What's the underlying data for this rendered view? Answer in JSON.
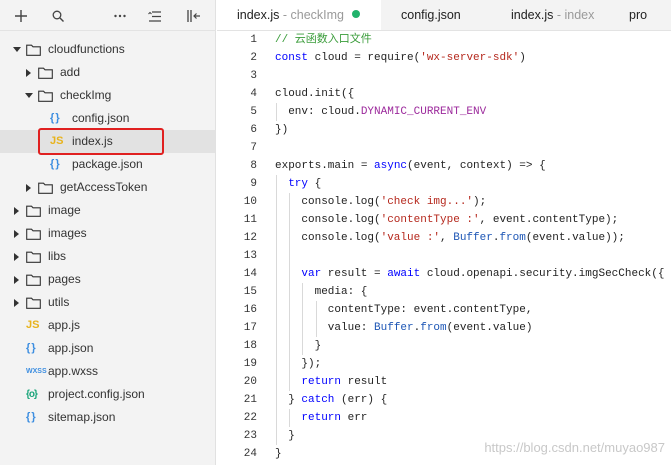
{
  "toolbar": {
    "icons": [
      "plus-icon",
      "search-icon",
      "more-icon",
      "sort-icon",
      "collapse-panel-icon"
    ]
  },
  "tree": [
    {
      "label": "cloudfunctions",
      "type": "folder",
      "open": true,
      "depth": 0
    },
    {
      "label": "add",
      "type": "folder",
      "open": false,
      "depth": 1
    },
    {
      "label": "checkImg",
      "type": "folder",
      "open": true,
      "depth": 1
    },
    {
      "label": "config.json",
      "type": "json",
      "depth": 2
    },
    {
      "label": "index.js",
      "type": "js",
      "depth": 2,
      "selected": true
    },
    {
      "label": "package.json",
      "type": "json",
      "depth": 2
    },
    {
      "label": "getAccessToken",
      "type": "folder",
      "open": false,
      "depth": 1
    },
    {
      "label": "image",
      "type": "folder",
      "open": false,
      "depth": 0
    },
    {
      "label": "images",
      "type": "folder",
      "open": false,
      "depth": 0
    },
    {
      "label": "libs",
      "type": "folder",
      "open": false,
      "depth": 0
    },
    {
      "label": "pages",
      "type": "folder",
      "open": false,
      "depth": 0
    },
    {
      "label": "utils",
      "type": "folder",
      "open": false,
      "depth": 0
    },
    {
      "label": "app.js",
      "type": "js",
      "depth": 0
    },
    {
      "label": "app.json",
      "type": "json",
      "depth": 0
    },
    {
      "label": "app.wxss",
      "type": "wxss",
      "depth": 0
    },
    {
      "label": "project.config.json",
      "type": "cfg",
      "depth": 0
    },
    {
      "label": "sitemap.json",
      "type": "json",
      "depth": 0
    }
  ],
  "file_badges": {
    "js": "JS",
    "json": "{ }",
    "wxss": "WXSS",
    "cfg": "{o}"
  },
  "tabs": [
    {
      "name": "index.js",
      "suffix": " - checkImg",
      "active": true,
      "modified_color": "#21b26b"
    },
    {
      "name": "config.json",
      "suffix": "",
      "active": false
    },
    {
      "name": "index.js",
      "suffix": " - index",
      "active": false
    },
    {
      "name": "pro",
      "suffix": "",
      "active": false
    }
  ],
  "code": [
    {
      "n": "1",
      "indent": 0,
      "tokens": [
        [
          "c",
          "// 云函数入口文件"
        ]
      ]
    },
    {
      "n": "2",
      "indent": 0,
      "tokens": [
        [
          "k",
          "const"
        ],
        [
          "p",
          " cloud = require("
        ],
        [
          "s",
          "'wx-server-sdk'"
        ],
        [
          "p",
          ")"
        ]
      ]
    },
    {
      "n": "3",
      "indent": 0,
      "tokens": []
    },
    {
      "n": "4",
      "indent": 0,
      "tokens": [
        [
          "p",
          "cloud.init({"
        ]
      ]
    },
    {
      "n": "5",
      "indent": 1,
      "tokens": [
        [
          "p",
          "env: cloud."
        ],
        [
          "v",
          "DYNAMIC_CURRENT_ENV"
        ]
      ]
    },
    {
      "n": "6",
      "indent": 0,
      "tokens": [
        [
          "p",
          "})"
        ]
      ]
    },
    {
      "n": "7",
      "indent": 0,
      "tokens": []
    },
    {
      "n": "8",
      "indent": 0,
      "tokens": [
        [
          "p",
          "exports.main = "
        ],
        [
          "k",
          "async"
        ],
        [
          "p",
          "(event, context) => {"
        ]
      ]
    },
    {
      "n": "9",
      "indent": 1,
      "tokens": [
        [
          "k",
          "try"
        ],
        [
          "p",
          " {"
        ]
      ]
    },
    {
      "n": "10",
      "indent": 2,
      "tokens": [
        [
          "p",
          "console.log("
        ],
        [
          "s",
          "'check img...'"
        ],
        [
          "p",
          ");"
        ]
      ]
    },
    {
      "n": "11",
      "indent": 2,
      "tokens": [
        [
          "p",
          "console.log("
        ],
        [
          "s",
          "'contentType :'"
        ],
        [
          "p",
          ", event.contentType);"
        ]
      ]
    },
    {
      "n": "12",
      "indent": 2,
      "tokens": [
        [
          "p",
          "console.log("
        ],
        [
          "s",
          "'value :'"
        ],
        [
          "p",
          ", "
        ],
        [
          "f",
          "Buffer"
        ],
        [
          "p",
          "."
        ],
        [
          "f",
          "from"
        ],
        [
          "p",
          "(event.value));"
        ]
      ]
    },
    {
      "n": "13",
      "indent": 2,
      "tokens": []
    },
    {
      "n": "14",
      "indent": 2,
      "tokens": [
        [
          "k",
          "var"
        ],
        [
          "p",
          " result = "
        ],
        [
          "k",
          "await"
        ],
        [
          "p",
          " cloud.openapi.security.imgSecCheck({"
        ]
      ]
    },
    {
      "n": "15",
      "indent": 3,
      "tokens": [
        [
          "p",
          "media: {"
        ]
      ]
    },
    {
      "n": "16",
      "indent": 4,
      "tokens": [
        [
          "p",
          "contentType: event.contentType,"
        ]
      ]
    },
    {
      "n": "17",
      "indent": 4,
      "tokens": [
        [
          "p",
          "value: "
        ],
        [
          "f",
          "Buffer"
        ],
        [
          "p",
          "."
        ],
        [
          "f",
          "from"
        ],
        [
          "p",
          "(event.value)"
        ]
      ]
    },
    {
      "n": "18",
      "indent": 3,
      "tokens": [
        [
          "p",
          "}"
        ]
      ]
    },
    {
      "n": "19",
      "indent": 2,
      "tokens": [
        [
          "p",
          "});"
        ]
      ]
    },
    {
      "n": "20",
      "indent": 2,
      "tokens": [
        [
          "k",
          "return"
        ],
        [
          "p",
          " result"
        ]
      ]
    },
    {
      "n": "21",
      "indent": 1,
      "tokens": [
        [
          "p",
          "} "
        ],
        [
          "k",
          "catch"
        ],
        [
          "p",
          " (err) {"
        ]
      ]
    },
    {
      "n": "22",
      "indent": 2,
      "tokens": [
        [
          "k",
          "return"
        ],
        [
          "p",
          " err"
        ]
      ]
    },
    {
      "n": "23",
      "indent": 1,
      "tokens": [
        [
          "p",
          "}"
        ]
      ]
    },
    {
      "n": "24",
      "indent": 0,
      "tokens": [
        [
          "p",
          "}"
        ]
      ]
    }
  ],
  "watermark": "https://blog.csdn.net/muyao987",
  "colors": {
    "highlight_box": "#e02020",
    "accent_green": "#21b26b"
  }
}
